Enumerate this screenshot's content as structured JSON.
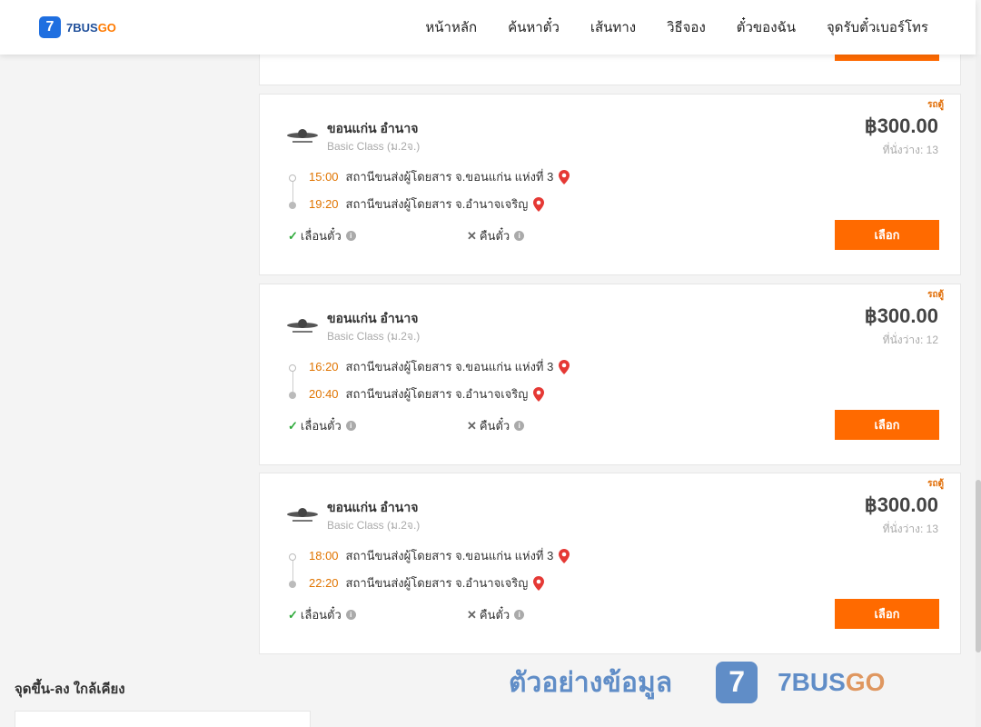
{
  "header": {
    "logo_mark": "7",
    "logo_brand_a": "7BUS",
    "logo_brand_b": "GO",
    "nav": [
      "หน้าหลัก",
      "ค้นหาตั๋ว",
      "เส้นทาง",
      "วิธีจอง",
      "ตั๋วของฉัน",
      "จุดรับตั๋วเบอร์โทร"
    ]
  },
  "trips": [
    {
      "badge": "รถตู้",
      "route": "ขอนแก่น อำนาจ",
      "class": "Basic Class (ม.2จ.)",
      "price": "฿300.00",
      "seats": "ที่นั่งว่าง: 13",
      "dep_time": "15:00",
      "dep_place": "สถานีขนส่งผู้โดยสาร จ.ขอนแก่น แห่งที่ 3",
      "arr_time": "19:20",
      "arr_place": "สถานีขนส่งผู้โดยสาร จ.อำนาจเจริญ",
      "policy_change": "เลื่อนตั๋ว",
      "policy_refund": "คืนตั๋ว",
      "button": "เลือก"
    },
    {
      "badge": "รถตู้",
      "route": "ขอนแก่น อำนาจ",
      "class": "Basic Class (ม.2จ.)",
      "price": "฿300.00",
      "seats": "ที่นั่งว่าง: 12",
      "dep_time": "16:20",
      "dep_place": "สถานีขนส่งผู้โดยสาร จ.ขอนแก่น แห่งที่ 3",
      "arr_time": "20:40",
      "arr_place": "สถานีขนส่งผู้โดยสาร จ.อำนาจเจริญ",
      "policy_change": "เลื่อนตั๋ว",
      "policy_refund": "คืนตั๋ว",
      "button": "เลือก"
    },
    {
      "badge": "รถตู้",
      "route": "ขอนแก่น อำนาจ",
      "class": "Basic Class (ม.2จ.)",
      "price": "฿300.00",
      "seats": "ที่นั่งว่าง: 13",
      "dep_time": "18:00",
      "dep_place": "สถานีขนส่งผู้โดยสาร จ.ขอนแก่น แห่งที่ 3",
      "arr_time": "22:20",
      "arr_place": "สถานีขนส่งผู้โดยสาร จ.อำนาจเจริญ",
      "policy_change": "เลื่อนตั๋ว",
      "policy_refund": "คืนตั๋ว",
      "button": "เลือก"
    }
  ],
  "sidebar": {
    "nearby_title": "จุดขึ้น-ลง ใกล้เคียง"
  },
  "watermark": {
    "text": "ตัวอย่างข้อมูล",
    "mark": "7",
    "brand_a": "7BUS",
    "brand_b": "GO"
  },
  "icons": {
    "check": "✓",
    "cross": "✕",
    "info": "i"
  },
  "colors": {
    "accent": "#ff6a00",
    "time": "#e07400",
    "brand": "#1f6fe0",
    "pin": "#e53935",
    "ok": "#2eaa3a"
  }
}
